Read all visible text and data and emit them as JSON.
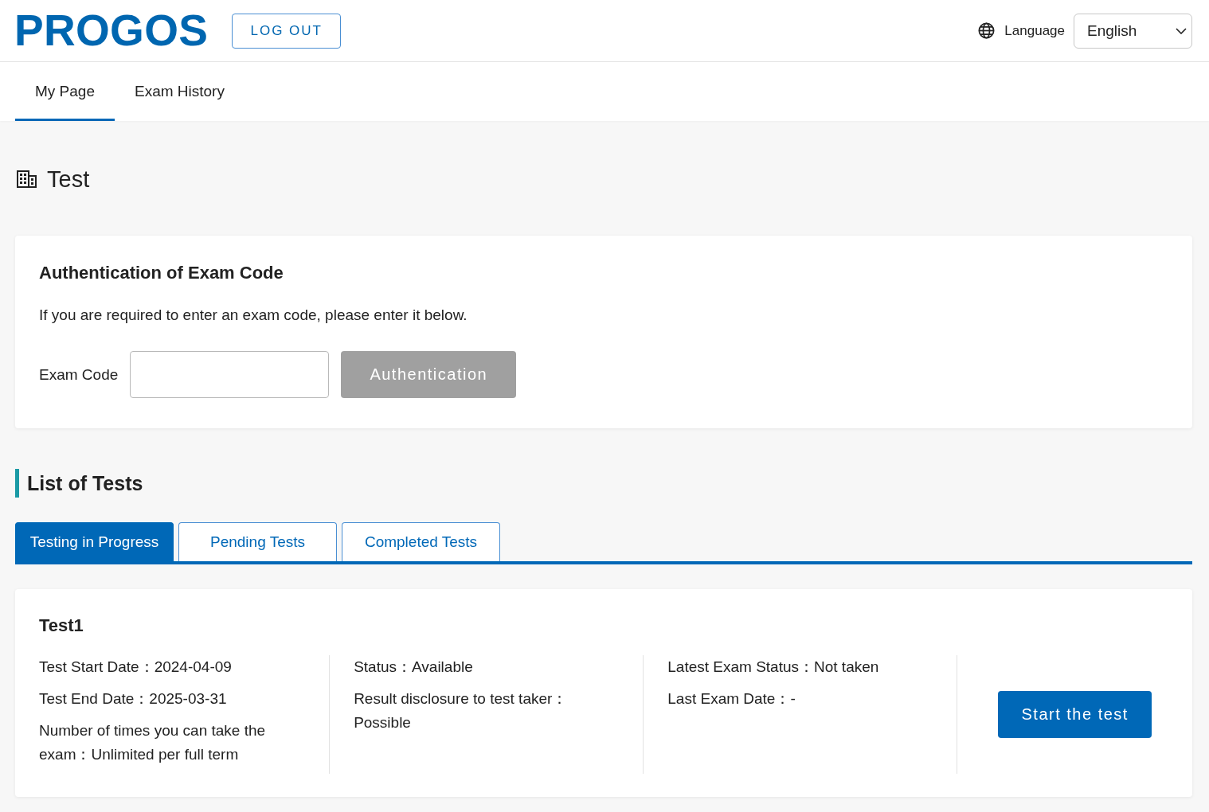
{
  "header": {
    "logo": "PROGOS",
    "logout_button": "LOG OUT",
    "language_label": "Language",
    "language_select": {
      "value": "English"
    }
  },
  "nav_tabs": [
    {
      "label": "My Page",
      "selected": true
    },
    {
      "label": "Exam History",
      "selected": false
    }
  ],
  "page_title": "Test",
  "auth_card": {
    "title": "Authentication of Exam Code",
    "description": "If you are required to enter an exam code, please enter it below.",
    "field_label": "Exam Code",
    "button": {
      "label": "Authentication",
      "disabled": true
    }
  },
  "test_list": {
    "title": "List of Tests",
    "tabs": [
      {
        "label": "Testing in Progress",
        "selected": true
      },
      {
        "label": "Pending Tests",
        "selected": false
      },
      {
        "label": "Completed Tests",
        "selected": false
      }
    ],
    "tests": [
      {
        "name": "Test1",
        "columns": [
          [
            "Test Start Date：2024-04-09",
            "Test End Date：2025-03-31",
            "Number of times you can take the exam：Unlimited per full term"
          ],
          [
            "Status：Available",
            "Result disclosure to test taker：Possible"
          ],
          [
            "Latest Exam Status：Not taken",
            "Last Exam Date：-"
          ]
        ],
        "button": "Start the test"
      }
    ]
  }
}
